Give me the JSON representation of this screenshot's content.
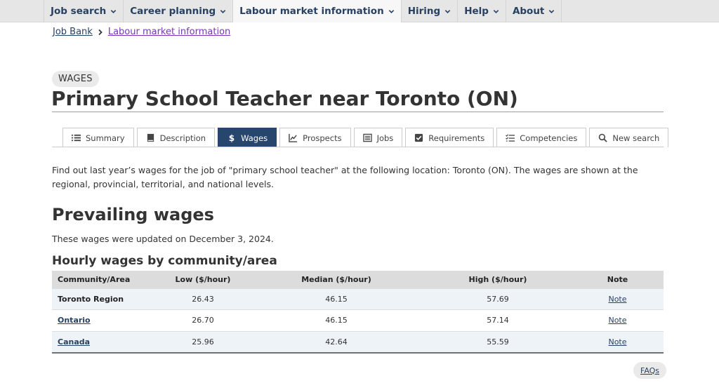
{
  "nav": {
    "items": [
      {
        "label": "Job search"
      },
      {
        "label": "Career planning"
      },
      {
        "label": "Labour market information"
      },
      {
        "label": "Hiring"
      },
      {
        "label": "Help"
      },
      {
        "label": "About"
      }
    ]
  },
  "breadcrumb": {
    "home": "Job Bank",
    "current": "Labour market information"
  },
  "header": {
    "kicker": "WAGES",
    "title": "Primary School Teacher near Toronto (ON)"
  },
  "tabs": [
    {
      "label": "Summary",
      "icon": "list-icon"
    },
    {
      "label": "Description",
      "icon": "book-icon"
    },
    {
      "label": "Wages",
      "icon": "dollar-icon"
    },
    {
      "label": "Prospects",
      "icon": "trend-chart-icon"
    },
    {
      "label": "Jobs",
      "icon": "jobs-list-icon"
    },
    {
      "label": "Requirements",
      "icon": "checkbox-icon"
    },
    {
      "label": "Competencies",
      "icon": "checklist-icon"
    },
    {
      "label": "New search",
      "icon": "search-icon"
    }
  ],
  "main": {
    "intro": "Find out last year’s wages for the job of \"primary school teacher\" at the following location: Toronto (ON). The wages are shown at the regional, provincial, territorial, and national levels.",
    "section_title": "Prevailing wages",
    "updated": "These wages were updated on December 3, 2024.",
    "table_title": "Hourly wages by community/area"
  },
  "table": {
    "headers": {
      "community": "Community/Area",
      "low": "Low ($/hour)",
      "median": "Median ($/hour)",
      "high": "High ($/hour)",
      "note": "Note"
    },
    "rows": [
      {
        "community": "Toronto Region",
        "low": "26.43",
        "median": "46.15",
        "high": "57.69",
        "note": "Note"
      },
      {
        "community": "Ontario",
        "low": "26.70",
        "median": "46.15",
        "high": "57.14",
        "note": "Note"
      },
      {
        "community": "Canada",
        "low": "25.96",
        "median": "42.64",
        "high": "55.59",
        "note": "Note"
      }
    ]
  },
  "faq": "FAQs",
  "colors": {
    "nav_text": "#284162",
    "active_tab": "#26466e",
    "visited_link": "#7834bc",
    "row_tint": "#eef3f8"
  }
}
